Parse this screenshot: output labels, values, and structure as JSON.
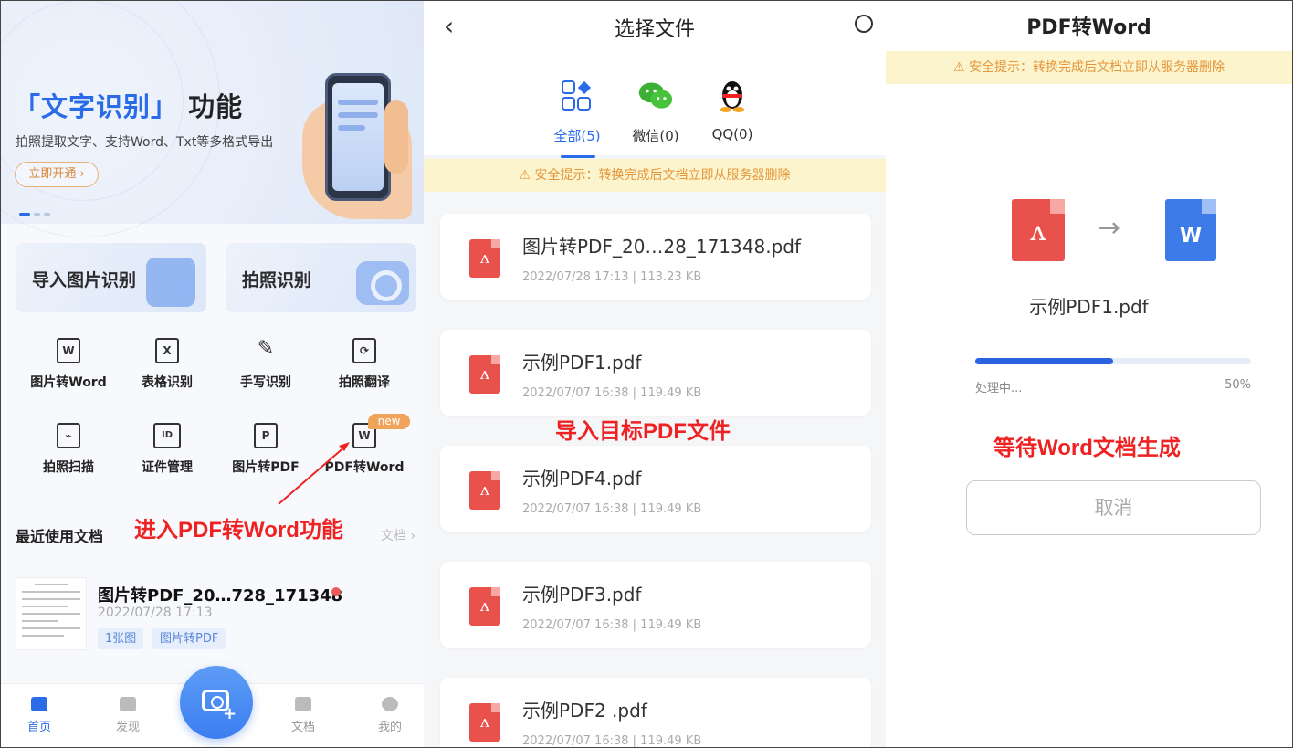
{
  "panel1": {
    "hero": {
      "title_open": "「",
      "title_highlight": "文字识别",
      "title_close": "」",
      "title_tail": "功能",
      "subtitle": "拍照提取文字、支持Word、Txt等多格式导出",
      "cta": "立即开通 ›"
    },
    "cards": [
      {
        "label": "导入图片识别",
        "icon": "image-frame-icon"
      },
      {
        "label": "拍照识别",
        "icon": "camera-icon"
      }
    ],
    "tools": [
      {
        "label": "图片转Word",
        "glyph": "W",
        "icon": "word-doc-icon"
      },
      {
        "label": "表格识别",
        "glyph": "X",
        "icon": "excel-doc-icon"
      },
      {
        "label": "手写识别",
        "glyph": "✎",
        "icon": "feather-pen-icon"
      },
      {
        "label": "拍照翻译",
        "glyph": "⟳",
        "icon": "translate-icon"
      },
      {
        "label": "拍照扫描",
        "glyph": "⌁",
        "icon": "scan-chart-icon"
      },
      {
        "label": "证件管理",
        "glyph": "ID",
        "icon": "id-card-icon"
      },
      {
        "label": "图片转PDF",
        "glyph": "P",
        "icon": "pdf-doc-icon"
      },
      {
        "label": "PDF转Word",
        "glyph": "W",
        "icon": "pdf-to-word-icon"
      }
    ],
    "new_badge": "new",
    "recent": {
      "heading": "最近使用文档",
      "more": "文档 ›",
      "doc": {
        "title": "图片转PDF_20…728_171348",
        "date": "2022/07/28 17:13",
        "tags": [
          "1张图",
          "图片转PDF"
        ]
      }
    },
    "tabbar": [
      {
        "label": "首页",
        "icon": "home-icon",
        "active": true
      },
      {
        "label": "发现",
        "icon": "cube-icon",
        "active": false
      },
      {
        "label": "文档",
        "icon": "document-icon",
        "active": false
      },
      {
        "label": "我的",
        "icon": "person-icon",
        "active": false
      }
    ],
    "annotation": "进入PDF转Word功能"
  },
  "panel2": {
    "title": "选择文件",
    "back": "‹",
    "sources": [
      {
        "label": "全部(5)",
        "icon": "all-grid-icon",
        "active": true
      },
      {
        "label": "微信(0)",
        "icon": "wechat-icon",
        "active": false
      },
      {
        "label": "QQ(0)",
        "icon": "qq-penguin-icon",
        "active": false
      }
    ],
    "warning": "⚠ 安全提示：转换完成后文档立即从服务器删除",
    "files": [
      {
        "name": "图片转PDF_20…28_171348.pdf",
        "meta": "2022/07/28 17:13  |   113.23 KB"
      },
      {
        "name": "示例PDF1.pdf",
        "meta": "2022/07/07 16:38  |   119.49 KB"
      },
      {
        "name": "示例PDF4.pdf",
        "meta": "2022/07/07 16:38  |   119.49 KB"
      },
      {
        "name": "示例PDF3.pdf",
        "meta": "2022/07/07 16:38  |   119.49 KB"
      },
      {
        "name": "示例PDF2 .pdf",
        "meta": "2022/07/07 16:38  |   119.49 KB"
      }
    ],
    "annotation": "导入目标PDF文件"
  },
  "panel3": {
    "title": "PDF转Word",
    "warning": "⚠ 安全提示：转换完成后文档立即从服务器删除",
    "filename": "示例PDF1.pdf",
    "status": "处理中...",
    "progress_label": "50%",
    "progress_fraction": 0.5,
    "cancel": "取消",
    "annotation": "等待Word文档生成"
  },
  "colors": {
    "accent": "#2a6be8",
    "annotation": "#ee2222",
    "pdf_red": "#e9514c",
    "warning_bg": "#fbf4cd",
    "warning_text": "#e5963a"
  }
}
